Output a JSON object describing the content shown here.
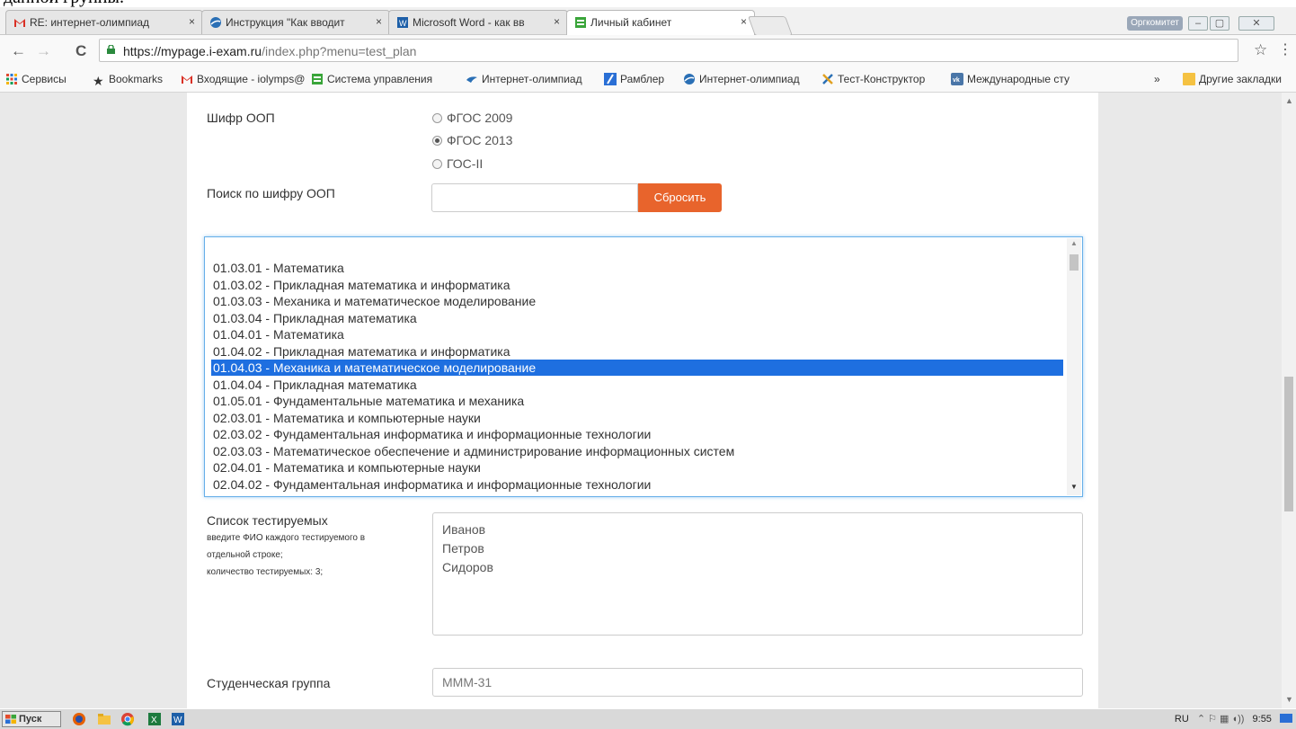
{
  "caption": "данной группы.",
  "tabs": [
    {
      "title": "RE: интернет-олимпиад",
      "close": "×"
    },
    {
      "title": "Инструкция \"Как вводит",
      "close": "×"
    },
    {
      "title": "Microsoft Word - как вв",
      "close": "×"
    },
    {
      "title": "Личный кабинет",
      "close": "×"
    }
  ],
  "window": {
    "profile": "Оргкомитет",
    "minimize": "–",
    "maximize": "▢",
    "close": "✕"
  },
  "address": {
    "host": "https://mypage.i-exam.ru",
    "path": "/index.php?menu=test_plan"
  },
  "nav": {
    "back": "←",
    "forward": "→",
    "reload": "C",
    "star": "☆",
    "menu": "⋮"
  },
  "bookmarks": [
    "Сервисы",
    "Bookmarks",
    "Входящие - iolymps@",
    "Система управления",
    "Интернет-олимпиад",
    "Рамблер",
    "Интернет-олимпиад",
    "Тест-Конструктор",
    "Международные сту"
  ],
  "bookmarks_more": "»",
  "bookmarks_other": "Другие закладки",
  "form": {
    "oop_label": "Шифр ООП",
    "standards": [
      "ФГОС 2009",
      "ФГОС 2013",
      "ГОС-II"
    ],
    "selected_standard": "ФГОС 2013",
    "search_label": "Поиск по шифру ООП",
    "search_value": "",
    "reset_label": "Сбросить",
    "programs": [
      "01.03.01 - Математика",
      "01.03.02 - Прикладная математика и информатика",
      "01.03.03 - Механика и математическое моделирование",
      "01.03.04 - Прикладная математика",
      "01.04.01 - Математика",
      "01.04.02 - Прикладная математика и информатика",
      "01.04.03 - Механика и математическое моделирование",
      "01.04.04 - Прикладная математика",
      "01.05.01 - Фундаментальные математика и механика",
      "02.03.01 - Математика и компьютерные науки",
      "02.03.02 - Фундаментальная информатика и информационные технологии",
      "02.03.03 - Математическое обеспечение и администрирование информационных систем",
      "02.04.01 - Математика и компьютерные науки",
      "02.04.02 - Фундаментальная информатика и информационные технологии"
    ],
    "selected_program": "01.04.03 - Механика и математическое моделирование",
    "testees_label": "Список тестируемых",
    "testees_hint_1": "введите ФИО каждого тестируемого в",
    "testees_hint_2": "отдельной строке;",
    "testees_count": "количество тестируемых: 3;",
    "testees": [
      "Иванов",
      "Петров",
      "Сидоров"
    ],
    "group_label": "Студенческая группа",
    "group_placeholder": "МММ-31"
  },
  "taskbar": {
    "start": "Пуск",
    "lang": "RU",
    "time": "9:55"
  },
  "colors": {
    "accent": "#e8642c",
    "selection": "#1e6fe0",
    "focus": "#66afe9"
  }
}
